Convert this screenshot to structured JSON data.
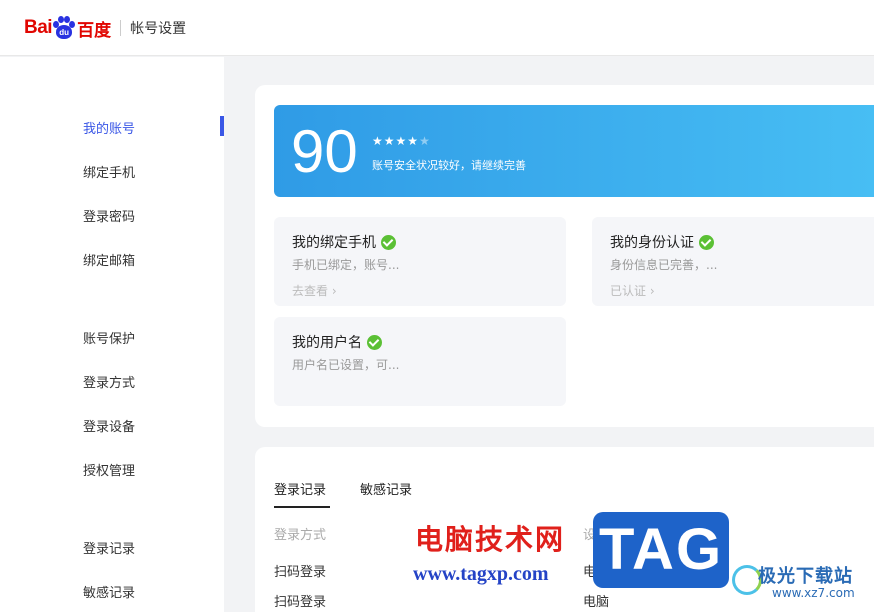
{
  "header": {
    "logo_latin": "Bai",
    "logo_paw_text": "du",
    "logo_cn": "百度",
    "page_title": "帐号设置"
  },
  "sidebar": {
    "items": [
      {
        "label": "我的账号",
        "active": true
      },
      {
        "label": "绑定手机"
      },
      {
        "label": "登录密码"
      },
      {
        "label": "绑定邮箱"
      },
      {
        "label": "账号保护"
      },
      {
        "label": "登录方式"
      },
      {
        "label": "登录设备"
      },
      {
        "label": "授权管理"
      },
      {
        "label": "登录记录"
      },
      {
        "label": "敏感记录"
      }
    ]
  },
  "security": {
    "score": "90",
    "stars_filled": 4,
    "stars_total": 5,
    "message": "账号安全状况较好，请继续完善",
    "banner_gradient": [
      "#2f9be6",
      "#48bff4"
    ]
  },
  "cards": [
    {
      "title": "我的绑定手机",
      "desc": "手机已绑定，账号...",
      "link": "去查看 ›"
    },
    {
      "title": "我的身份认证",
      "desc": "身份信息已完善，...",
      "link": "已认证 ›"
    },
    {
      "title": "我的用户名",
      "desc": "用户名已设置，可..."
    }
  ],
  "records": {
    "tabs": [
      "登录记录",
      "敏感记录"
    ],
    "columns": [
      "登录方式",
      "设备"
    ],
    "rows": [
      [
        "扫码登录",
        "电脑"
      ],
      [
        "扫码登录",
        "电脑"
      ]
    ]
  },
  "watermark": {
    "title": "电脑技术网",
    "url": "www.tagxp.com",
    "tag": "TAG",
    "brand": "极光下载站",
    "brand_url": "www.xz7.com"
  },
  "colors": {
    "accent": "#3a57e6",
    "check": "#5bc035",
    "brand_red": "#e10601"
  }
}
